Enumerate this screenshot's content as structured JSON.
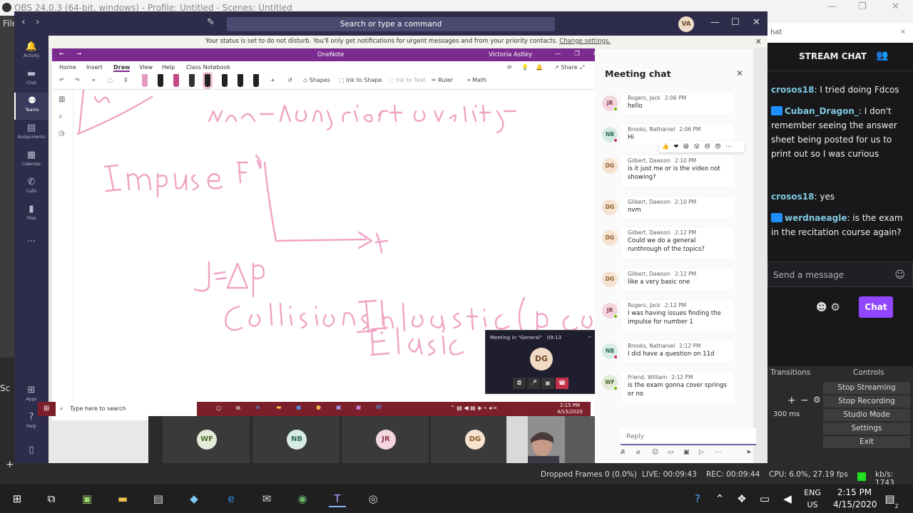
{
  "obs": {
    "title": "OBS 24.0.3 (64-bit, windows) - Profile: Untitled - Scenes: Untitled",
    "menu_file": "File",
    "scenes_label": "Sc",
    "dock_tabs": [
      "Transitions",
      "Controls"
    ],
    "duration": "300 ms",
    "buttons": [
      "Stop Streaming",
      "Stop Recording",
      "Studio Mode",
      "Settings",
      "Exit"
    ],
    "status": {
      "dropped": "Dropped Frames 0 (0.0%)",
      "live": "LIVE: 00:09:43",
      "rec": "REC: 00:09:44",
      "cpu": "CPU: 6.0%, 27.19 fps",
      "kbs": "kb/s: 1743"
    }
  },
  "teams": {
    "search_placeholder": "Search or type a command",
    "profile_initials": "VA",
    "rail": [
      {
        "label": "Activity",
        "icon": "bell-icon"
      },
      {
        "label": "Chat",
        "icon": "chat-icon"
      },
      {
        "label": "Teams",
        "icon": "teams-icon"
      },
      {
        "label": "Assignments",
        "icon": "assignments-icon"
      },
      {
        "label": "Calendar",
        "icon": "calendar-icon"
      },
      {
        "label": "Calls",
        "icon": "phone-icon"
      },
      {
        "label": "Files",
        "icon": "files-icon"
      }
    ],
    "rail_bottom": [
      {
        "label": "Apps",
        "icon": "apps-icon"
      },
      {
        "label": "Help",
        "icon": "help-icon"
      }
    ],
    "banner_text": "Your status is set to do not disturb. You'll only get notifications for urgent messages and from your priority contacts.",
    "banner_link": "Change settings.",
    "participants": [
      {
        "initials": "WF",
        "bg": "#e3ecd9",
        "fg": "#4e6b2f"
      },
      {
        "initials": "NB",
        "bg": "#d6ebe3",
        "fg": "#2f6b55"
      },
      {
        "initials": "JR",
        "bg": "#f3d6dd",
        "fg": "#8a3a4c"
      },
      {
        "initials": "DG",
        "bg": "#f6e3cf",
        "fg": "#8a5a2b"
      }
    ]
  },
  "onenote": {
    "app_title": "OneNote",
    "user": "Victoria Astley",
    "tabs": [
      "Home",
      "Insert",
      "Draw",
      "View",
      "Help",
      "Class Notebook"
    ],
    "active_tab": "Draw",
    "share": "Share",
    "tools": [
      "Shapes",
      "Ink to Shape",
      "Ink to Text",
      "Ruler",
      "Math"
    ],
    "ink_color": "#f0a3c4"
  },
  "remote_taskbar": {
    "search": "Type here to search",
    "time": "2:15 PM",
    "date": "4/15/2020"
  },
  "meeting_mini": {
    "title": "Meeting in \"General\"",
    "timer": "09:13",
    "initials": "DG"
  },
  "meeting_chat": {
    "title": "Meeting chat",
    "reply_placeholder": "Reply",
    "messages": [
      {
        "initials": "JR",
        "name": "Rogers, Jack",
        "time": "2:06 PM",
        "text": "hello",
        "bg": "#f3d6dd",
        "fg": "#8a3a4c",
        "status": "#6bb700"
      },
      {
        "initials": "NB",
        "name": "Brooks, Nathaniel",
        "time": "2:06 PM",
        "text": "Hi",
        "bg": "#d6ebe3",
        "fg": "#2f6b55",
        "status": "#c4314b"
      },
      {
        "initials": "DG",
        "name": "Gilbert, Dawson",
        "time": "2:10 PM",
        "text": "is it just me or is the video not showing?",
        "bg": "#f6e3cf",
        "fg": "#8a5a2b",
        "status": ""
      },
      {
        "initials": "DG",
        "name": "Gilbert, Dawson",
        "time": "2:10 PM",
        "text": "nvm",
        "bg": "#f6e3cf",
        "fg": "#8a5a2b",
        "status": ""
      },
      {
        "initials": "DG",
        "name": "Gilbert, Dawson",
        "time": "2:12 PM",
        "text": "Could we do a general runthrough of the topics?",
        "bg": "#f6e3cf",
        "fg": "#8a5a2b",
        "status": ""
      },
      {
        "initials": "DG",
        "name": "Gilbert, Dawson",
        "time": "2:12 PM",
        "text": "like a very basic one",
        "bg": "#f6e3cf",
        "fg": "#8a5a2b",
        "status": ""
      },
      {
        "initials": "JR",
        "name": "Rogers, Jack",
        "time": "2:12 PM",
        "text": "I was having issues finding the impulse for number 1",
        "bg": "#f3d6dd",
        "fg": "#8a3a4c",
        "status": "#6bb700"
      },
      {
        "initials": "NB",
        "name": "Brooks, Nathaniel",
        "time": "2:12 PM",
        "text": "I did have a question on 11d",
        "bg": "#d6ebe3",
        "fg": "#2f6b55",
        "status": "#c4314b"
      },
      {
        "initials": "WF",
        "name": "Friend, William",
        "time": "2:12 PM",
        "text": "is the exam gonna cover springs or no",
        "bg": "#e3ecd9",
        "fg": "#4e6b2f",
        "status": "#6bb700"
      }
    ],
    "reactions": "👍 ❤ 😆 😮 😢 😠"
  },
  "stream_chat": {
    "search_text": "hat",
    "title": "STREAM CHAT",
    "messages": [
      {
        "user": "crosos18",
        "text": ": I tried doing Fdcos",
        "badge": false
      },
      {
        "user": "Cuban_Dragon_",
        "text": ": I don't remember seeing the answer sheet being posted for us to print out so I was curious",
        "badge": true
      },
      {
        "user": "crosos18",
        "text": ": yes",
        "badge": false
      },
      {
        "user": "werdnaeagle",
        "text": ": is the exam in the recitation course again?",
        "badge": true
      }
    ],
    "send_placeholder": "Send a message",
    "chat_button": "Chat"
  },
  "taskbar": {
    "lang": "ENG",
    "region": "US",
    "time": "2:15 PM",
    "date": "4/15/2020",
    "notif_count": "2"
  }
}
